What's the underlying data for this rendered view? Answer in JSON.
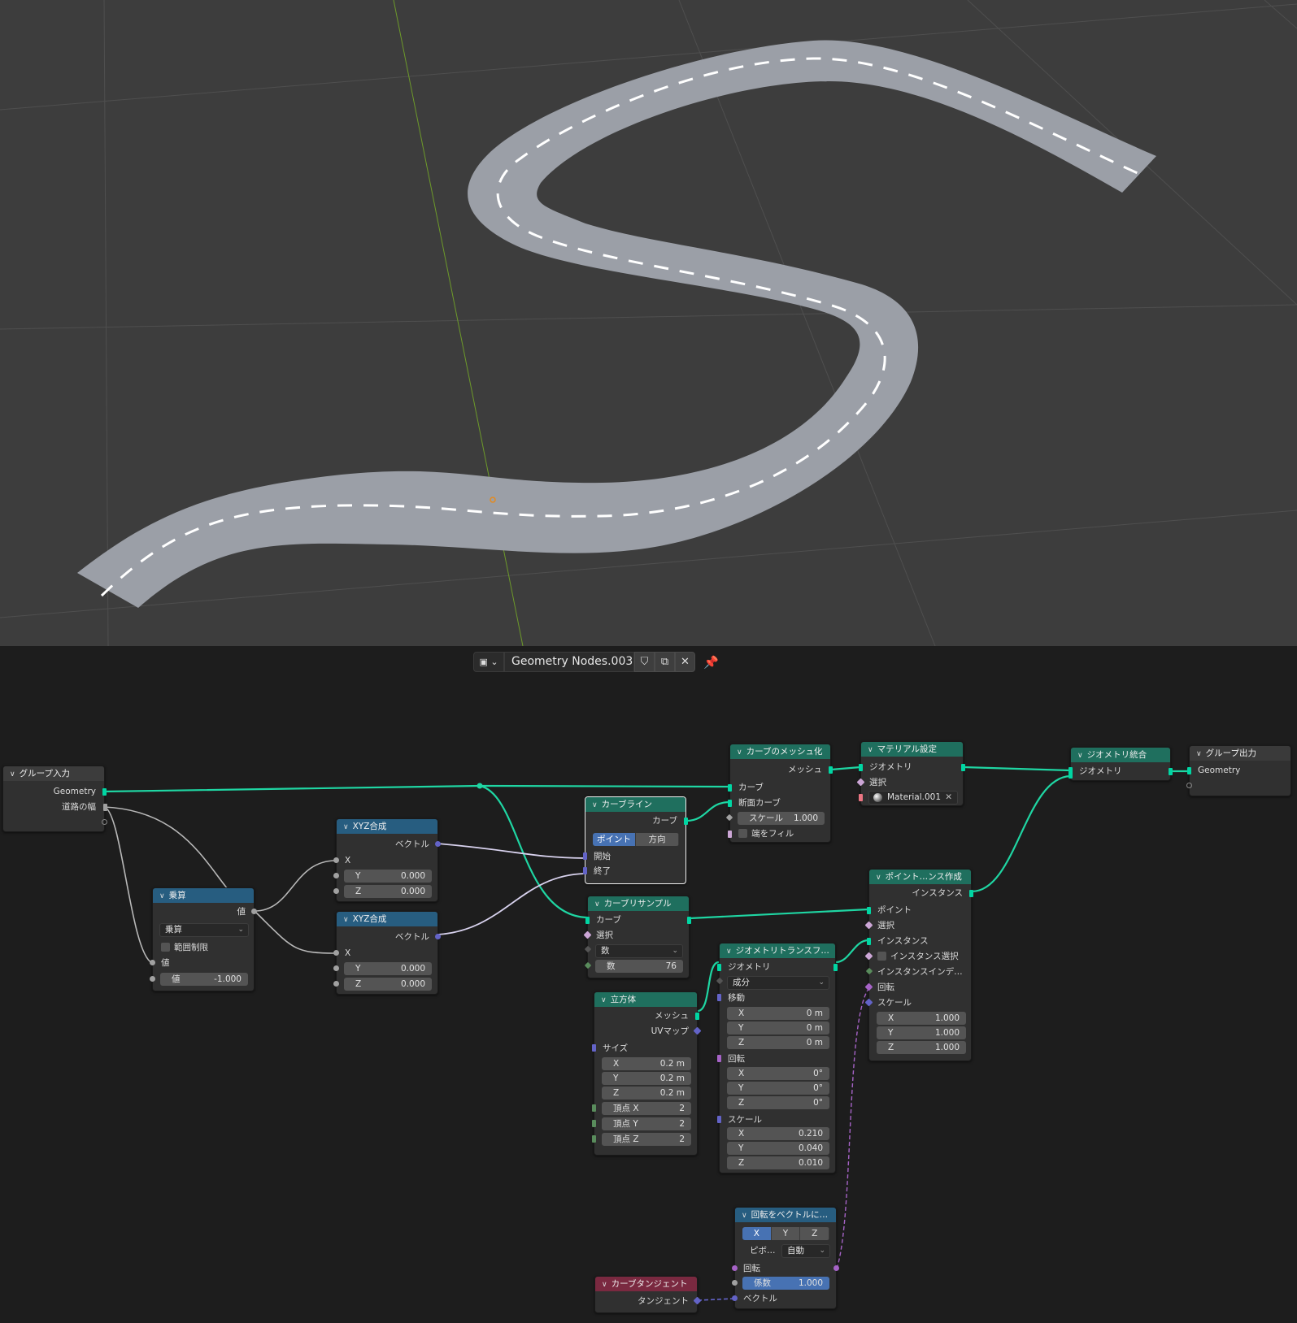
{
  "editor": {
    "tree_name": "Geometry Nodes.003",
    "type_icon": "node-tree-icon",
    "buttons": [
      "shield-icon",
      "duplicate-icon",
      "close-icon",
      "pin-icon"
    ]
  },
  "nodes": {
    "group_input": {
      "title": "グループ入力",
      "geometry": "Geometry",
      "width": "道路の幅"
    },
    "multiply": {
      "title": "乗算",
      "op": "乗算",
      "clamp": "範囲制限",
      "value_a": "値",
      "value_b_label": "値",
      "value_b": "-1.000",
      "out": "値"
    },
    "xyz1": {
      "title": "XYZ合成",
      "out": "ベクトル",
      "x": "X",
      "y_label": "Y",
      "y": "0.000",
      "z_label": "Z",
      "z": "0.000"
    },
    "xyz2": {
      "title": "XYZ合成",
      "out": "ベクトル",
      "x": "X",
      "y_label": "Y",
      "y": "0.000",
      "z_label": "Z",
      "z": "0.000"
    },
    "curve_line": {
      "title": "カーブライン",
      "out": "カーブ",
      "mode_a": "ポイント",
      "mode_b": "方向",
      "start": "開始",
      "end": "終了"
    },
    "curve_to_mesh": {
      "title": "カーブのメッシュ化",
      "out": "メッシュ",
      "curve": "カーブ",
      "profile": "断面カーブ",
      "scale_label": "スケール",
      "scale": "1.000",
      "fill": "端をフィル"
    },
    "set_material": {
      "title": "マテリアル設定",
      "geo": "ジオメトリ",
      "sel": "選択",
      "material": "Material.001"
    },
    "join": {
      "title": "ジオメトリ統合",
      "geo": "ジオメトリ"
    },
    "group_output": {
      "title": "グループ出力",
      "geo": "Geometry"
    },
    "resample": {
      "title": "カーブリサンプル",
      "curve_in": "カーブ",
      "sel": "選択",
      "mode": "数",
      "count_label": "数",
      "count": "76"
    },
    "instance": {
      "title": "ポイント…ンス作成",
      "out": "インスタンス",
      "points": "ポイント",
      "sel": "選択",
      "inst": "インスタンス",
      "inst_sel": "インスタンス選択",
      "inst_idx": "インスタンスインデ…",
      "rot": "回転",
      "scale": "スケール",
      "sx": "1.000",
      "sy": "1.000",
      "sz": "1.000"
    },
    "transform": {
      "title": "ジオメトリトランスフ…",
      "geo": "ジオメトリ",
      "mode": "成分",
      "translate": "移動",
      "tx": "0 m",
      "ty": "0 m",
      "tz": "0 m",
      "rotate": "回転",
      "rx": "0°",
      "ry": "0°",
      "rz": "0°",
      "scale": "スケール",
      "sx": "0.210",
      "sy": "0.040",
      "sz": "0.010"
    },
    "cube": {
      "title": "立方体",
      "mesh": "メッシュ",
      "uv": "UVマップ",
      "size": "サイズ",
      "x": "0.2 m",
      "y": "0.2 m",
      "z": "0.2 m",
      "vx_label": "頂点 X",
      "vx": "2",
      "vy_label": "頂点 Y",
      "vy": "2",
      "vz_label": "頂点 Z",
      "vz": "2"
    },
    "align": {
      "title": "回転をベクトルに…",
      "ax": "X",
      "ay": "Y",
      "az": "Z",
      "pivot_label": "ピボ…",
      "pivot": "自動",
      "rot": "回転",
      "factor_label": "係数",
      "factor": "1.000",
      "vec": "ベクトル"
    },
    "tangent": {
      "title": "カーブタンジェント",
      "out": "タンジェント"
    }
  },
  "labels": {
    "x": "X",
    "y": "Y",
    "z": "Z"
  },
  "colors": {
    "viewport_bg": "#3d3d3d",
    "road": "#9b9fa7",
    "editor_bg": "#1d1d1d",
    "geo_wire": "#00d6a3",
    "selected_outline": "#f0f0f0"
  }
}
